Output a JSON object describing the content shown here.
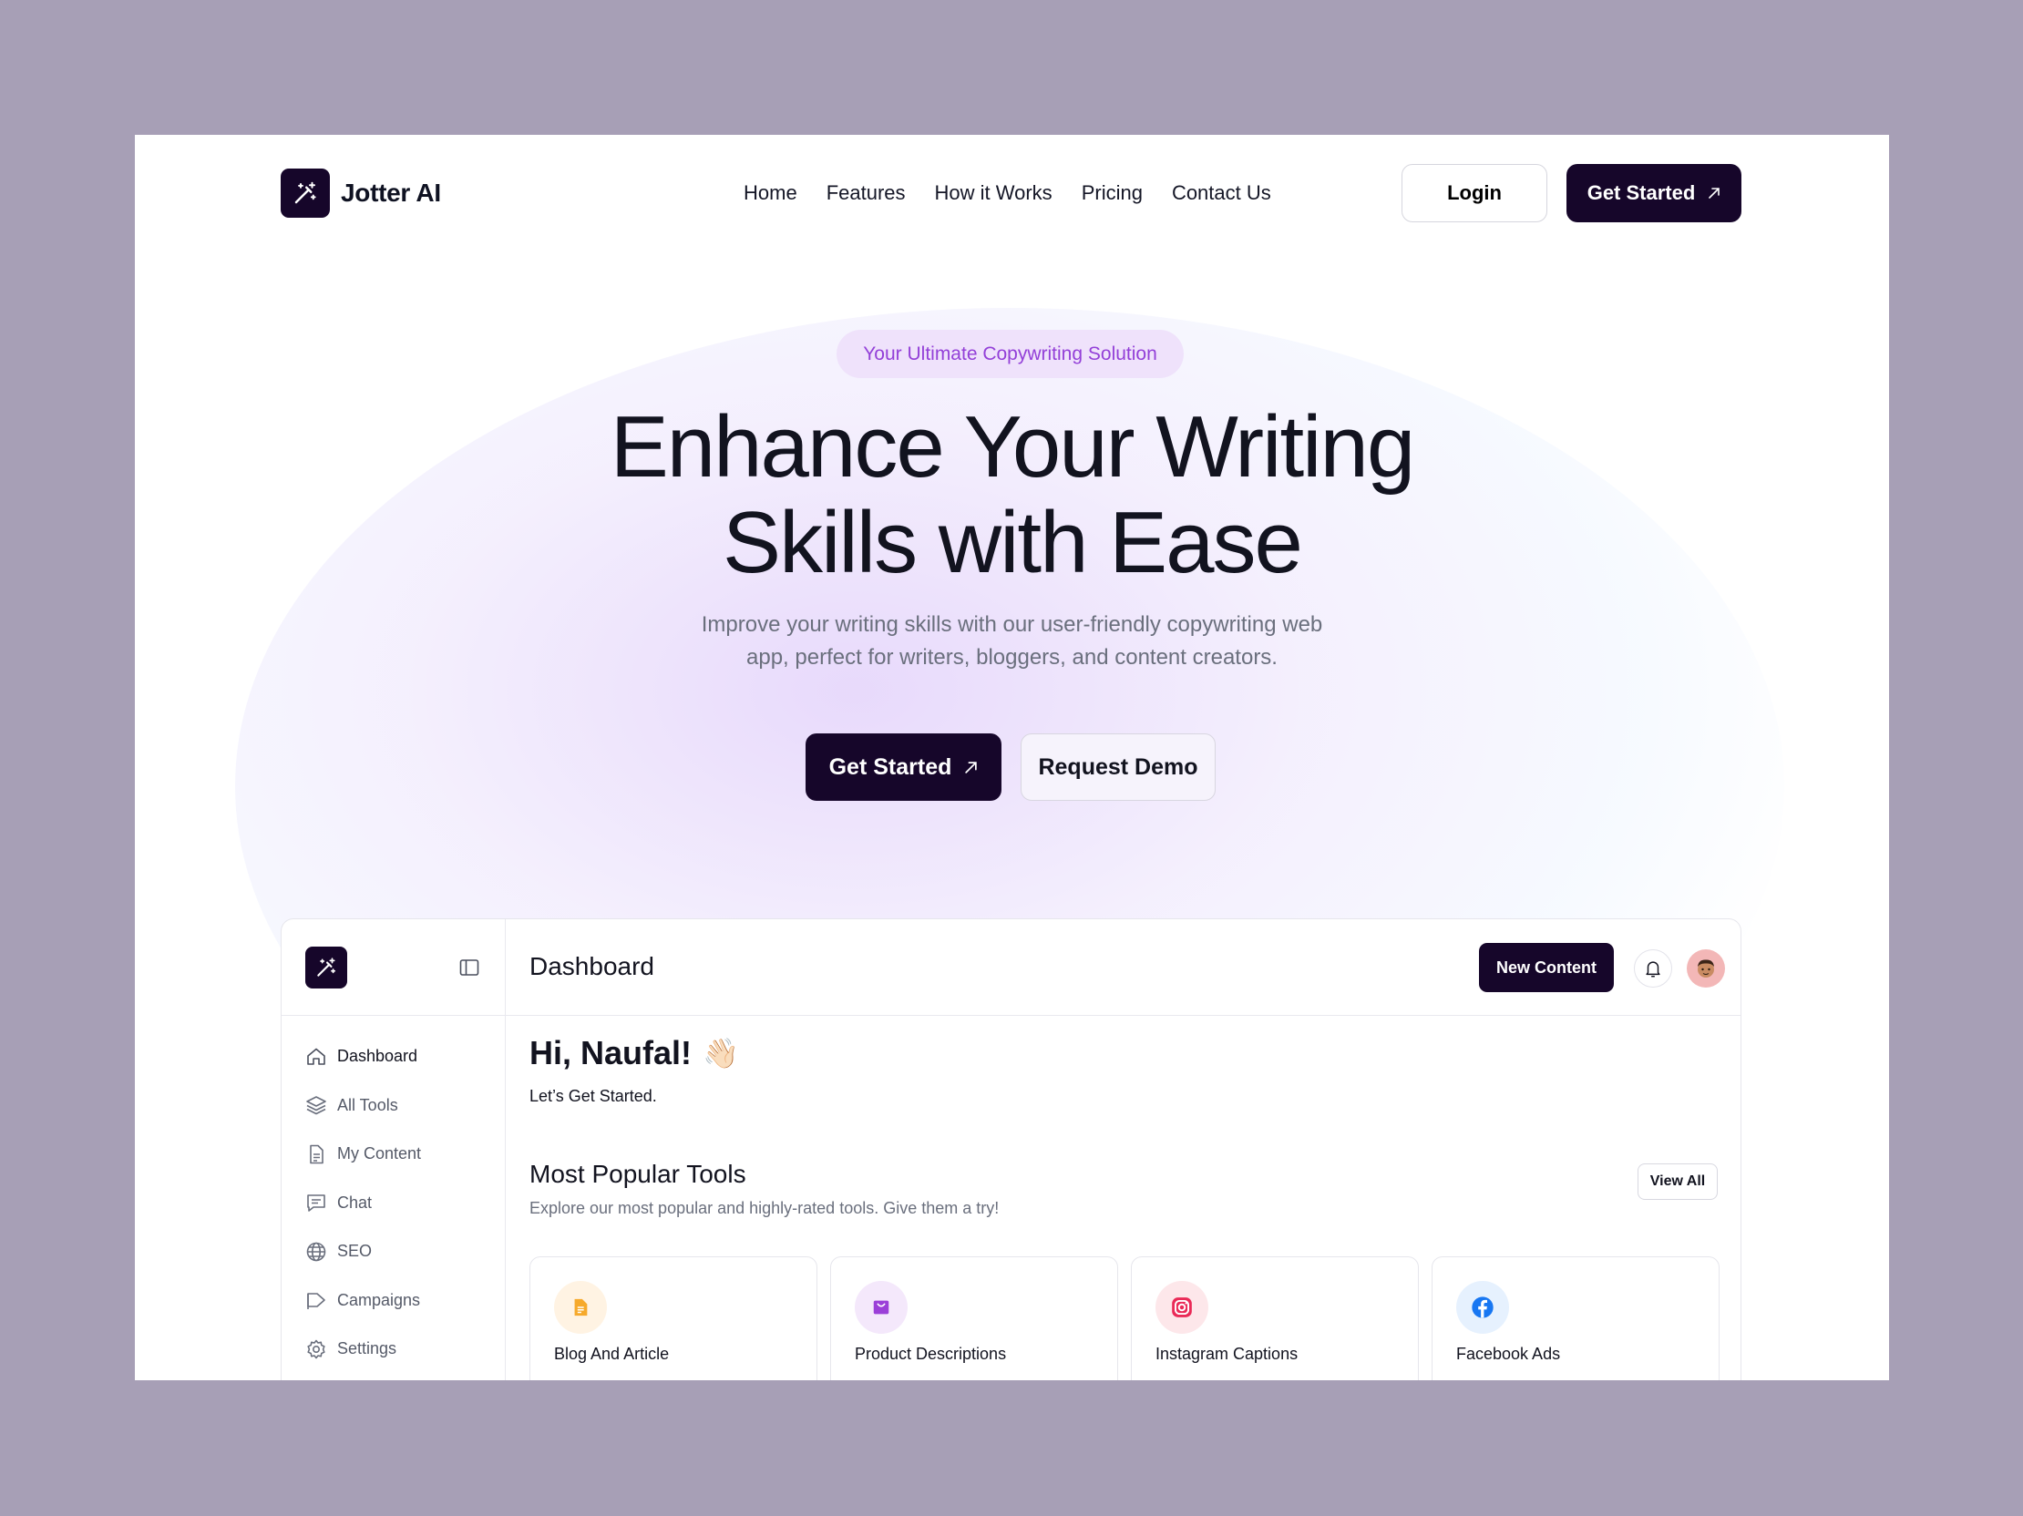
{
  "colors": {
    "background": "#a79fb6",
    "brand_dark": "#16062a",
    "pill_bg": "#efe2fb",
    "pill_text": "#9340d8",
    "muted_text": "#6a6f7d"
  },
  "nav": {
    "brand": "Jotter AI",
    "logo_icon": "magic-wand-icon",
    "links": [
      "Home",
      "Features",
      "How it Works",
      "Pricing",
      "Contact Us"
    ],
    "login_label": "Login",
    "get_started_label": "Get Started",
    "arrow_icon": "arrow-up-right-icon"
  },
  "hero": {
    "pill": "Your Ultimate Copywriting Solution",
    "title_line1": "Enhance Your Writing",
    "title_line2": "Skills with Ease",
    "subtitle_line1": "Improve your writing skills with our user-friendly copywriting web",
    "subtitle_line2": "app, perfect for writers, bloggers, and content creators.",
    "primary_cta": "Get Started",
    "secondary_cta": "Request Demo"
  },
  "dashboard": {
    "title": "Dashboard",
    "new_content_label": "New Content",
    "sidebar": [
      {
        "label": "Dashboard",
        "icon": "home-icon",
        "active": true
      },
      {
        "label": "All Tools",
        "icon": "layers-icon",
        "active": false
      },
      {
        "label": "My Content",
        "icon": "document-icon",
        "active": false
      },
      {
        "label": "Chat",
        "icon": "chat-icon",
        "active": false
      },
      {
        "label": "SEO",
        "icon": "globe-icon",
        "active": false
      },
      {
        "label": "Campaigns",
        "icon": "megaphone-icon",
        "active": false
      },
      {
        "label": "Settings",
        "icon": "gear-icon",
        "active": false
      }
    ],
    "greeting": "Hi, Naufal!",
    "greeting_emoji": "👋🏻",
    "greeting_sub": "Let’s Get Started.",
    "section_title": "Most Popular Tools",
    "section_sub": "Explore our most popular and highly-rated tools. Give them a try!",
    "view_all_label": "View All",
    "tools": [
      {
        "label": "Blog And Article",
        "icon": "document-icon",
        "bg": "#fff3e3",
        "color": "#f6a92b"
      },
      {
        "label": "Product Descriptions",
        "icon": "shopping-bag-icon",
        "bg": "#f4e8fb",
        "color": "#9b3fd8"
      },
      {
        "label": "Instagram Captions",
        "icon": "instagram-icon",
        "bg": "#fde7ea",
        "color": "#ea2a57"
      },
      {
        "label": "Facebook Ads",
        "icon": "facebook-icon",
        "bg": "#e6f1fe",
        "color": "#1877f2"
      }
    ]
  }
}
